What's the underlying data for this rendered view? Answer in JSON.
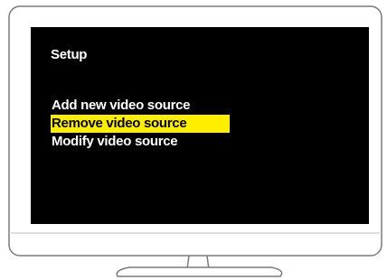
{
  "screen": {
    "title": "Setup",
    "menu_items": [
      {
        "label": "Add new video source",
        "selected": false
      },
      {
        "label": "Remove video source",
        "selected": true
      },
      {
        "label": "Modify video source",
        "selected": false
      }
    ]
  },
  "colors": {
    "screen_background": "#000000",
    "text": "#ffffff",
    "highlight": "#ffee00",
    "highlight_text": "#000000",
    "bezel_outline": "#7a7a7a"
  }
}
